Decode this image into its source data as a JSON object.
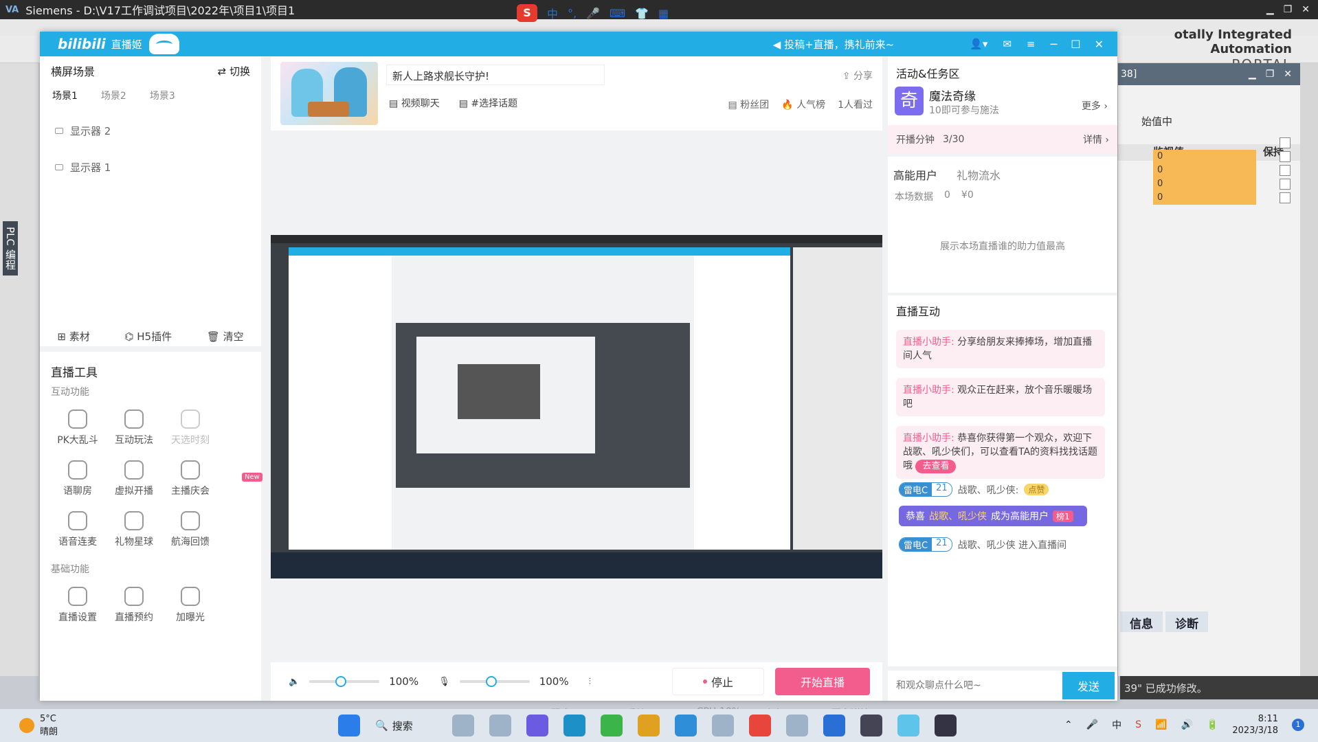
{
  "tia": {
    "title": "Siemens  -  D:\\V17工作调试项目\\2022年\\项目1\\项目1",
    "portal_line1": "otally Integrated Automation",
    "portal_line2": "PORTAL",
    "left_vertical": "PLC 编程",
    "panel_num": "38]",
    "monitoring": "始值中",
    "col_watch": "监视值",
    "col_hold": "保持",
    "watch_values": [
      "0",
      "0",
      "0",
      "0"
    ],
    "info_tab": "信息",
    "diag_tab": "诊断",
    "status_text": "39\" 已成功修改。"
  },
  "ime": {
    "s": "S",
    "items": [
      "中",
      "°,",
      "🎤",
      "⌨",
      "👕",
      "▦"
    ]
  },
  "bili": {
    "logo": "bilibili",
    "logo_sub": "直播姬",
    "promo": "◀ 投稿+直播，携礼前来~",
    "left": {
      "header": "横屏场景",
      "switch": "切换",
      "tabs": [
        "场景1",
        "场景2",
        "场景3"
      ],
      "sources": [
        "显示器 2",
        "显示器 1"
      ],
      "actions": [
        "素材",
        "H5插件",
        "清空"
      ],
      "tools_title": "直播工具",
      "group_interactive": "互动功能",
      "group_basic": "基础功能",
      "interactive_tools": [
        "PK大乱斗",
        "互动玩法",
        "天选时刻",
        "语聊房",
        "虚拟开播",
        "主播庆会",
        "语音连麦",
        "礼物星球",
        "航海回馈"
      ],
      "new_badge": "New",
      "basic_tools": [
        "直播设置",
        "直播预约",
        "加曝光"
      ]
    },
    "room": {
      "title": "新人上路求舰长守护!",
      "share": "分享",
      "tag_video": "视频聊天",
      "tag_topic": "#选择话题",
      "fans": "粉丝团",
      "popular": "人气榜",
      "watching": "1人看过"
    },
    "controls": {
      "speaker_pct": "100%",
      "mic_pct": "100%",
      "stop": "停止",
      "start": "开始直播"
    },
    "stats": {
      "bitrate": "码率:0kbps",
      "drop": "丢帧:0.0%",
      "cpu": "CPU:10%",
      "mem": "内存:37%",
      "more": "更多详情 ›"
    },
    "right": {
      "activity_title": "活动&任务区",
      "act_icon": "奇",
      "act_name": "魔法奇缘",
      "act_sub": "10即可参与施法",
      "act_more": "更多 ›",
      "kpi_label": "开播分钟",
      "kpi_value": "3/30",
      "kpi_detail": "详情 ›",
      "hp_tab": "高能用户",
      "gift_tab": "礼物流水",
      "session_data": "本场数据",
      "people": "0",
      "yuan": "¥0",
      "empty": "展示本场直播谁的助力值最高",
      "interact_title": "直播互动",
      "chats": [
        {
          "who": "直播小助手:",
          "text": " 分享给朋友来捧捧场，增加直播间人气"
        },
        {
          "who": "直播小助手:",
          "text": " 观众正在赶来，放个音乐暖暖场吧"
        },
        {
          "who": "直播小助手:",
          "text": " 恭喜你获得第一个观众，欢迎下战歌、吼少侠们，可以查看TA的资料找找话题哦"
        }
      ],
      "go_view": "去查看",
      "medal_name": "雷电C",
      "medal_lv": "21",
      "m1_text": "战歌、吼少侠:",
      "m1_gold": "点赞",
      "congrats_pre": "恭喜",
      "congrats_name": "战歌、吼少侠",
      "congrats_post": "成为高能用户",
      "congrats_lv": "榜1",
      "m2_text": "战歌、吼少侠 进入直播间",
      "input_placeholder": "和观众聊点什么吧~",
      "send": "发送"
    }
  },
  "taskbar": {
    "temp": "5°C",
    "weather": "晴朗",
    "search": "搜索",
    "lang": "中",
    "time": "8:11",
    "date": "2023/3/18",
    "notif": "1"
  }
}
